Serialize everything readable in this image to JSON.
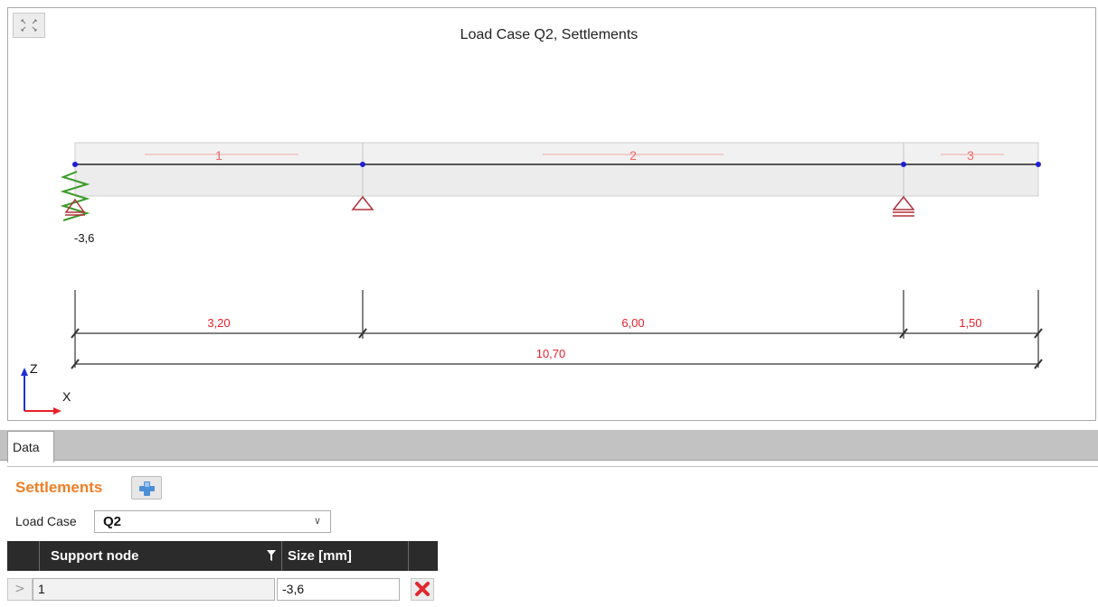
{
  "canvas": {
    "title": "Load Case Q2, Settlements",
    "fullscreen_icon": "expand-arrows-icon",
    "member_labels": [
      "1",
      "2",
      "3"
    ],
    "settlement_value": "-3,6",
    "span_dimensions": [
      "3,20",
      "6,00",
      "1,50"
    ],
    "total_dimension": "10,70",
    "axis_labels": {
      "z": "Z",
      "x": "X"
    },
    "colors": {
      "dimension_text": "#e8202a",
      "node": "#1f1fd8",
      "support": "#b0303a",
      "spring": "#3a9a28"
    }
  },
  "tabs": {
    "data_label": "Data"
  },
  "panel": {
    "section_title": "Settlements",
    "add_icon": "plus-icon",
    "load_case_label": "Load Case",
    "load_case_value": "Q2",
    "table": {
      "headers": {
        "support_node": "Support node",
        "size": "Size [mm]"
      },
      "rows": [
        {
          "support_node": "1",
          "size": "-3,6"
        }
      ]
    },
    "delete_icon": "delete-x-icon"
  }
}
